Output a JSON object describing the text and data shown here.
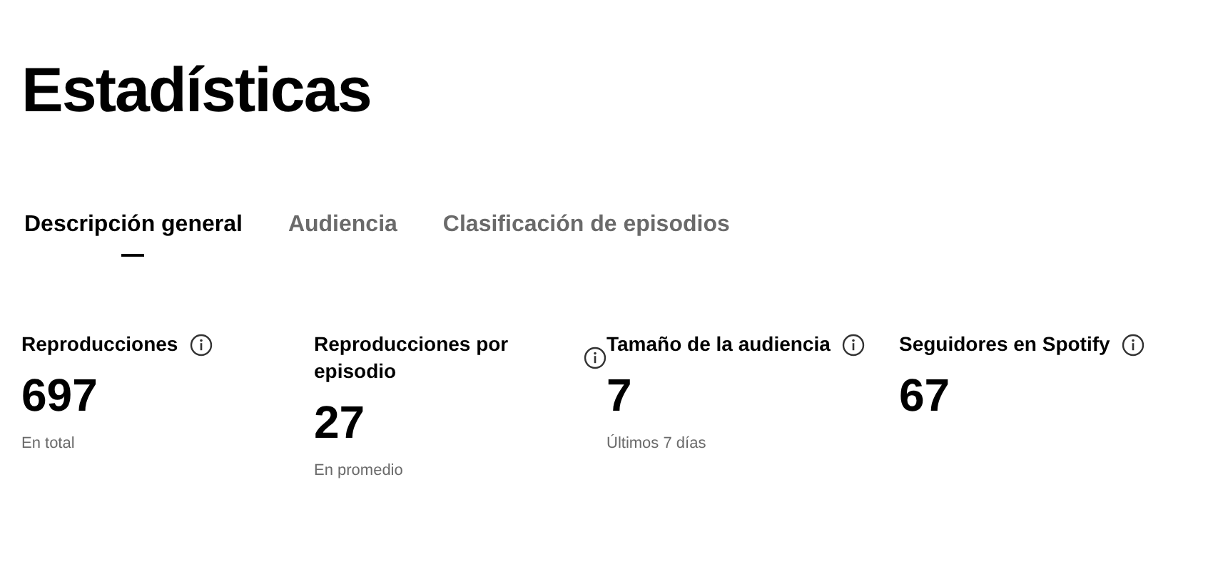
{
  "title": "Estadísticas",
  "tabs": [
    {
      "label": "Descripción general",
      "selected": true
    },
    {
      "label": "Audiencia",
      "selected": false
    },
    {
      "label": "Clasificación de episodios",
      "selected": false
    }
  ],
  "stats": [
    {
      "label": "Reproducciones",
      "value": "697",
      "note": "En total"
    },
    {
      "label": "Reproducciones por episodio",
      "value": "27",
      "note": "En promedio"
    },
    {
      "label": "Tamaño de la audiencia",
      "value": "7",
      "note": "Últimos 7 días"
    },
    {
      "label": "Seguidores en Spotify",
      "value": "67"
    }
  ]
}
